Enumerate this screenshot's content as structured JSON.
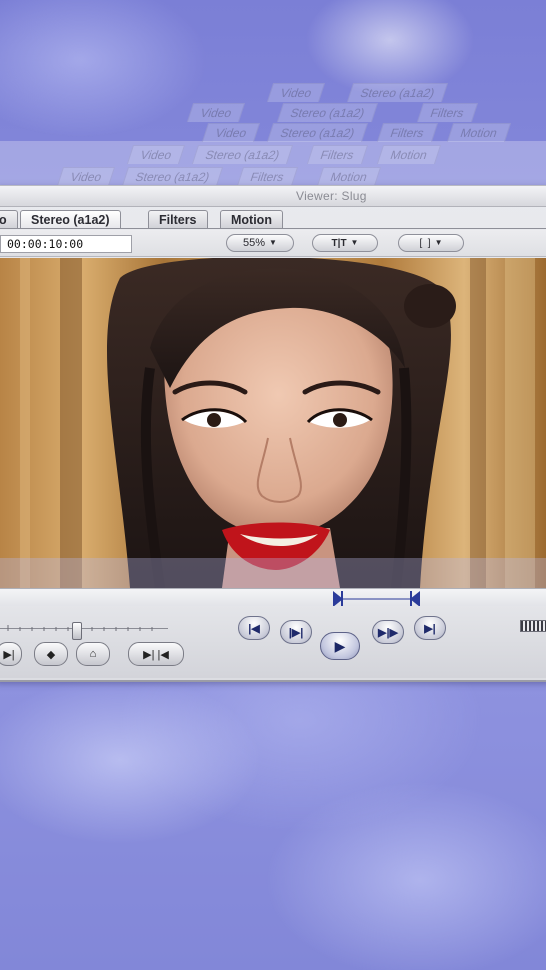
{
  "window": {
    "title": "Viewer: Slug"
  },
  "tabs": [
    {
      "label": "o"
    },
    {
      "label": "Stereo (a1a2)"
    },
    {
      "label": "Filters"
    },
    {
      "label": "Motion"
    }
  ],
  "ghost_tabs": [
    [
      "Video",
      "Stereo (a1a2)",
      "Filters",
      "Motion"
    ]
  ],
  "toolbar": {
    "timecode": "00:00:10:00",
    "zoom": "55%",
    "view_mode_icon": "text-overlay-icon",
    "fit_icon": "frame-fit-icon"
  },
  "transport": {
    "playhead_position": 0.43,
    "in_marker_icon": "in-point-icon",
    "out_marker_icon": "out-point-icon",
    "buttons": [
      {
        "icon": "go-to-previous-edit-icon"
      },
      {
        "icon": "play-in-to-out-icon"
      },
      {
        "icon": "play-icon"
      },
      {
        "icon": "play-around-current-icon"
      },
      {
        "icon": "go-to-next-edit-icon"
      }
    ],
    "left_buttons": [
      {
        "icon": "mark-in-icon"
      },
      {
        "icon": "add-marker-icon"
      },
      {
        "icon": "add-keyframe-icon"
      },
      {
        "icon": "mark-in-out-icon"
      }
    ]
  },
  "colors": {
    "background": "#8a8edd",
    "chrome": "#e2e3e7",
    "accent": "#2b3b9a",
    "lips": "#c0141b"
  }
}
